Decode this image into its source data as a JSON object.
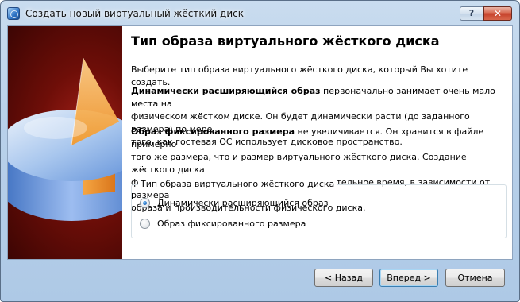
{
  "window": {
    "title": "Создать новый виртуальный жёсткий диск",
    "help_label": "?",
    "close_label": "✕"
  },
  "page": {
    "title": "Тип образа виртуального жёсткого диска",
    "intro": "Выберите тип образа виртуального жёсткого диска, который Вы хотите создать.",
    "dynamic_bold": "Динамически расширяющийся образ",
    "dynamic_text_1": " первоначально занимает очень мало места на",
    "dynamic_text_2": "физическом жёстком диске. Он будет динамически расти (до заданного размера) по мере",
    "dynamic_text_3": "того, как гостевая ОС использует дисковое пространство.",
    "fixed_bold": "Образ фиксированного размера",
    "fixed_text_1": " не увеличивается. Он хранится в файле примерно",
    "fixed_text_2": "того же размера, что и размер виртуального жёсткого диска. Создание жёсткого диска",
    "fixed_text_3": "фиксированного размера может занять длительное время, в зависимости от размера",
    "fixed_text_4": "образа и производительности физического диска."
  },
  "image_type_group": {
    "legend": "Тип образа виртуального жёсткого диска",
    "options": [
      {
        "label": "Динамически расширяющийся образ",
        "checked": true
      },
      {
        "label": "Образ фиксированного размера",
        "checked": false
      }
    ]
  },
  "buttons": {
    "back": "< Назад",
    "next": "Вперед >",
    "cancel": "Отмена"
  },
  "colors": {
    "side_background": "#6e0e08",
    "disk_blue": "#7fa9e4",
    "disk_orange": "#f5a23a"
  },
  "icons": {
    "title_icon": "virtualbox-icon",
    "side_image": "hard-disk-pie-illustration"
  }
}
